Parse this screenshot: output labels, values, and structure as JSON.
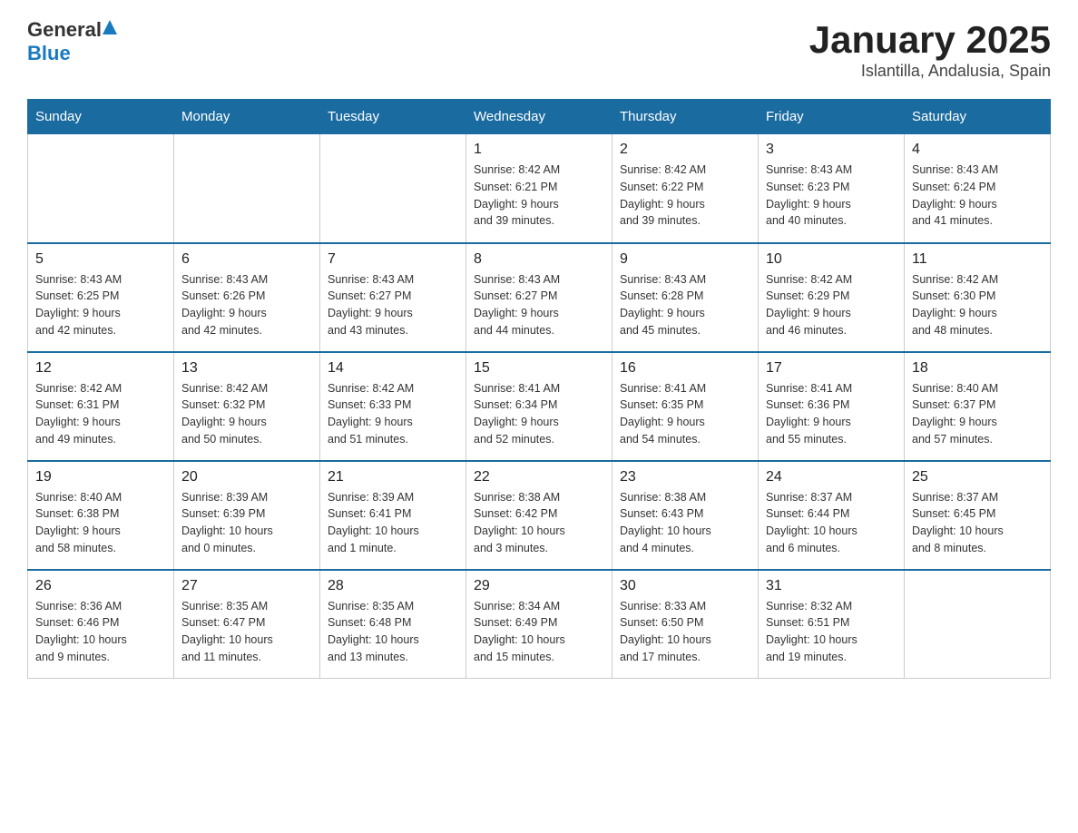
{
  "header": {
    "logo_text_general": "General",
    "logo_text_blue": "Blue",
    "month_year": "January 2025",
    "location": "Islantilla, Andalusia, Spain"
  },
  "days_of_week": [
    "Sunday",
    "Monday",
    "Tuesday",
    "Wednesday",
    "Thursday",
    "Friday",
    "Saturday"
  ],
  "weeks": [
    {
      "days": [
        {
          "number": "",
          "info": ""
        },
        {
          "number": "",
          "info": ""
        },
        {
          "number": "",
          "info": ""
        },
        {
          "number": "1",
          "info": "Sunrise: 8:42 AM\nSunset: 6:21 PM\nDaylight: 9 hours\nand 39 minutes."
        },
        {
          "number": "2",
          "info": "Sunrise: 8:42 AM\nSunset: 6:22 PM\nDaylight: 9 hours\nand 39 minutes."
        },
        {
          "number": "3",
          "info": "Sunrise: 8:43 AM\nSunset: 6:23 PM\nDaylight: 9 hours\nand 40 minutes."
        },
        {
          "number": "4",
          "info": "Sunrise: 8:43 AM\nSunset: 6:24 PM\nDaylight: 9 hours\nand 41 minutes."
        }
      ]
    },
    {
      "days": [
        {
          "number": "5",
          "info": "Sunrise: 8:43 AM\nSunset: 6:25 PM\nDaylight: 9 hours\nand 42 minutes."
        },
        {
          "number": "6",
          "info": "Sunrise: 8:43 AM\nSunset: 6:26 PM\nDaylight: 9 hours\nand 42 minutes."
        },
        {
          "number": "7",
          "info": "Sunrise: 8:43 AM\nSunset: 6:27 PM\nDaylight: 9 hours\nand 43 minutes."
        },
        {
          "number": "8",
          "info": "Sunrise: 8:43 AM\nSunset: 6:27 PM\nDaylight: 9 hours\nand 44 minutes."
        },
        {
          "number": "9",
          "info": "Sunrise: 8:43 AM\nSunset: 6:28 PM\nDaylight: 9 hours\nand 45 minutes."
        },
        {
          "number": "10",
          "info": "Sunrise: 8:42 AM\nSunset: 6:29 PM\nDaylight: 9 hours\nand 46 minutes."
        },
        {
          "number": "11",
          "info": "Sunrise: 8:42 AM\nSunset: 6:30 PM\nDaylight: 9 hours\nand 48 minutes."
        }
      ]
    },
    {
      "days": [
        {
          "number": "12",
          "info": "Sunrise: 8:42 AM\nSunset: 6:31 PM\nDaylight: 9 hours\nand 49 minutes."
        },
        {
          "number": "13",
          "info": "Sunrise: 8:42 AM\nSunset: 6:32 PM\nDaylight: 9 hours\nand 50 minutes."
        },
        {
          "number": "14",
          "info": "Sunrise: 8:42 AM\nSunset: 6:33 PM\nDaylight: 9 hours\nand 51 minutes."
        },
        {
          "number": "15",
          "info": "Sunrise: 8:41 AM\nSunset: 6:34 PM\nDaylight: 9 hours\nand 52 minutes."
        },
        {
          "number": "16",
          "info": "Sunrise: 8:41 AM\nSunset: 6:35 PM\nDaylight: 9 hours\nand 54 minutes."
        },
        {
          "number": "17",
          "info": "Sunrise: 8:41 AM\nSunset: 6:36 PM\nDaylight: 9 hours\nand 55 minutes."
        },
        {
          "number": "18",
          "info": "Sunrise: 8:40 AM\nSunset: 6:37 PM\nDaylight: 9 hours\nand 57 minutes."
        }
      ]
    },
    {
      "days": [
        {
          "number": "19",
          "info": "Sunrise: 8:40 AM\nSunset: 6:38 PM\nDaylight: 9 hours\nand 58 minutes."
        },
        {
          "number": "20",
          "info": "Sunrise: 8:39 AM\nSunset: 6:39 PM\nDaylight: 10 hours\nand 0 minutes."
        },
        {
          "number": "21",
          "info": "Sunrise: 8:39 AM\nSunset: 6:41 PM\nDaylight: 10 hours\nand 1 minute."
        },
        {
          "number": "22",
          "info": "Sunrise: 8:38 AM\nSunset: 6:42 PM\nDaylight: 10 hours\nand 3 minutes."
        },
        {
          "number": "23",
          "info": "Sunrise: 8:38 AM\nSunset: 6:43 PM\nDaylight: 10 hours\nand 4 minutes."
        },
        {
          "number": "24",
          "info": "Sunrise: 8:37 AM\nSunset: 6:44 PM\nDaylight: 10 hours\nand 6 minutes."
        },
        {
          "number": "25",
          "info": "Sunrise: 8:37 AM\nSunset: 6:45 PM\nDaylight: 10 hours\nand 8 minutes."
        }
      ]
    },
    {
      "days": [
        {
          "number": "26",
          "info": "Sunrise: 8:36 AM\nSunset: 6:46 PM\nDaylight: 10 hours\nand 9 minutes."
        },
        {
          "number": "27",
          "info": "Sunrise: 8:35 AM\nSunset: 6:47 PM\nDaylight: 10 hours\nand 11 minutes."
        },
        {
          "number": "28",
          "info": "Sunrise: 8:35 AM\nSunset: 6:48 PM\nDaylight: 10 hours\nand 13 minutes."
        },
        {
          "number": "29",
          "info": "Sunrise: 8:34 AM\nSunset: 6:49 PM\nDaylight: 10 hours\nand 15 minutes."
        },
        {
          "number": "30",
          "info": "Sunrise: 8:33 AM\nSunset: 6:50 PM\nDaylight: 10 hours\nand 17 minutes."
        },
        {
          "number": "31",
          "info": "Sunrise: 8:32 AM\nSunset: 6:51 PM\nDaylight: 10 hours\nand 19 minutes."
        },
        {
          "number": "",
          "info": ""
        }
      ]
    }
  ]
}
